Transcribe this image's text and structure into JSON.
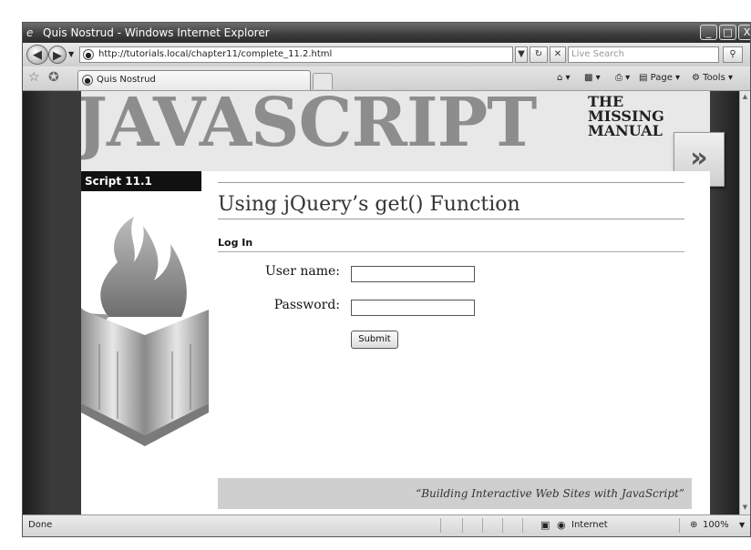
{
  "window": {
    "title": "Quis Nostrud - Windows Internet Explorer",
    "minimize": "_",
    "maximize": "□",
    "close": "X"
  },
  "address": {
    "url": "http://tutorials.local/chapter11/complete_11.2.html",
    "search_placeholder": "Live Search"
  },
  "tabs": [
    {
      "label": "Quis Nostrud"
    }
  ],
  "toolbar": {
    "page_label": "Page",
    "tools_label": "Tools"
  },
  "banner": {
    "logo_word": "JAVASCRIPT",
    "logo_line1": "THE",
    "logo_line2": "MISSING",
    "logo_line3": "MANUAL",
    "arrow": "»"
  },
  "sidebar": {
    "script_label": "Script 11.1"
  },
  "main": {
    "title": "Using jQuery’s get() Function",
    "section_heading": "Log In",
    "fields": [
      {
        "label": "User name:",
        "value": ""
      },
      {
        "label": "Password:",
        "value": ""
      }
    ],
    "submit_label": "Submit",
    "footer_quote": "“Building Interactive Web Sites with JavaScript”"
  },
  "status": {
    "text": "Done",
    "zone": "Internet",
    "zoom": "100%"
  },
  "colors": {
    "titlebar": "#3c3c3c",
    "page_background": "#3a3a3a",
    "logo_gray": "#8d8d8d",
    "footer_gray": "#cfcfcf"
  }
}
